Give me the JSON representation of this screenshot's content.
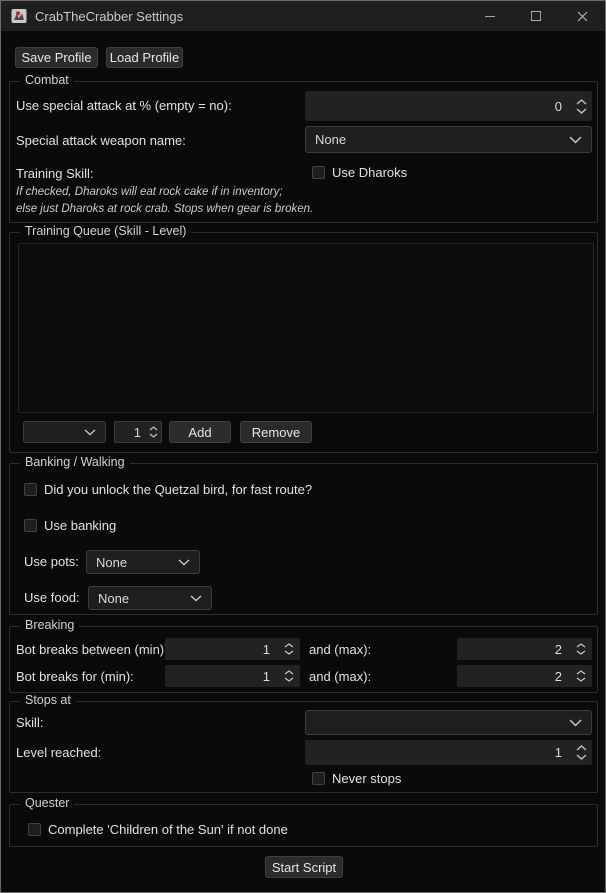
{
  "window": {
    "title": "CrabTheCrabber Settings"
  },
  "toolbar": {
    "save_label": "Save Profile",
    "load_label": "Load Profile"
  },
  "combat": {
    "legend": "Combat",
    "spec_label": "Use special attack at % (empty = no):",
    "spec_value": "0",
    "weapon_label": "Special attack weapon name:",
    "weapon_value": "None",
    "training_skill_label": "Training Skill:",
    "use_dharoks_label": "Use Dharoks",
    "use_dharoks_checked": false,
    "note_line1": "If checked, Dharoks will eat rock cake if in inventory;",
    "note_line2": "else just Dharoks at rock crab. Stops when gear is broken."
  },
  "training_queue": {
    "legend": "Training Queue (Skill - Level)",
    "items": [],
    "skill_value": "",
    "level_value": "1",
    "add_label": "Add",
    "remove_label": "Remove"
  },
  "banking": {
    "legend": "Banking / Walking",
    "quetzal_label": "Did you unlock the Quetzal bird, for fast route?",
    "quetzal_checked": false,
    "use_banking_label": "Use banking",
    "use_banking_checked": false,
    "use_pots_label": "Use pots:",
    "use_pots_value": "None",
    "use_food_label": "Use food:",
    "use_food_value": "None"
  },
  "breaking": {
    "legend": "Breaking",
    "between_label": "Bot breaks between (min):",
    "between_min": "1",
    "between_and_label": "and (max):",
    "between_max": "2",
    "for_label": "Bot breaks for (min):",
    "for_min": "1",
    "for_and_label": "and (max):",
    "for_max": "2"
  },
  "stops": {
    "legend": "Stops at",
    "skill_label": "Skill:",
    "skill_value": "",
    "level_label": "Level reached:",
    "level_value": "1",
    "never_label": "Never stops",
    "never_checked": false
  },
  "quester": {
    "legend": "Quester",
    "quest_label": "Complete 'Children of the Sun' if not done",
    "quest_checked": false
  },
  "footer": {
    "start_label": "Start Script"
  },
  "colors": {
    "window_bg": "#0a0a0a",
    "titlebar_bg": "#1f1f1f",
    "control_bg": "#222222",
    "button_bg": "#2b2b2b",
    "border": "#2d2d2d",
    "text": "#e2e2e2",
    "icon_red_dot": "#cc2222"
  }
}
